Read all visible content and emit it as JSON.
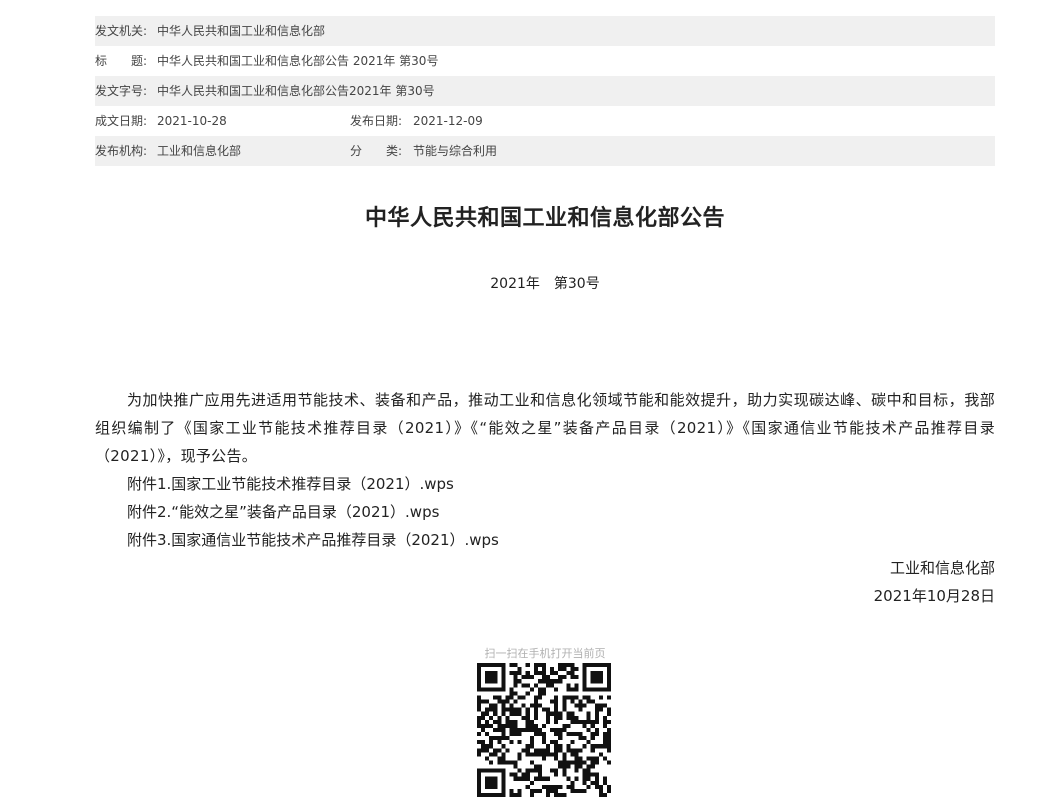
{
  "meta": {
    "issuer_label": "发文机关:",
    "issuer": "中华人民共和国工业和信息化部",
    "title_label": "标　　题:",
    "title": "中华人民共和国工业和信息化部公告 2021年 第30号",
    "docnum_label": "发文字号:",
    "docnum": "中华人民共和国工业和信息化部公告2021年 第30号",
    "written_label": "成文日期:",
    "written_date": "2021-10-28",
    "publish_label": "发布日期:",
    "publish_date": "2021-12-09",
    "org_label": "发布机构:",
    "org": "工业和信息化部",
    "category_label": "分　　类:",
    "category": "节能与综合利用"
  },
  "document": {
    "title": "中华人民共和国工业和信息化部公告",
    "number": "2021年　第30号",
    "paragraph": "为加快推广应用先进适用节能技术、装备和产品，推动工业和信息化领域节能和能效提升，助力实现碳达峰、碳中和目标，我部组织编制了《国家工业节能技术推荐目录（2021）》《“能效之星”装备产品目录（2021）》《国家通信业节能技术产品推荐目录（2021）》，现予公告。",
    "attachments": [
      "附件1.国家工业节能技术推荐目录（2021）.wps",
      "附件2.“能效之星”装备产品目录（2021）.wps",
      "附件3.国家通信业节能技术产品推荐目录（2021）.wps"
    ],
    "signer": "工业和信息化部",
    "sign_date": "2021年10月28日"
  },
  "qr": {
    "label": "扫一扫在手机打开当前页",
    "icon": "qr-code-icon"
  }
}
